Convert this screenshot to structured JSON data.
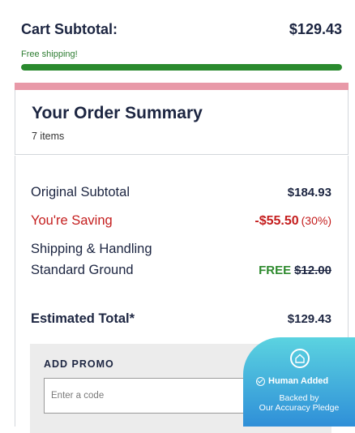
{
  "cart": {
    "subtotal_label": "Cart Subtotal:",
    "subtotal_value": "$129.43",
    "shipping_note": "Free shipping!",
    "shipping_progress": 1.0
  },
  "summary": {
    "title": "Your Order Summary",
    "item_count": "7 items",
    "original_label": "Original Subtotal",
    "original_value": "$184.93",
    "saving_label": "You're Saving",
    "saving_value": "-$55.50",
    "saving_percent": "(30%)",
    "shipping_label": "Shipping & Handling",
    "shipping_method": "Standard Ground",
    "shipping_free": "FREE",
    "shipping_original": "$12.00",
    "total_label": "Estimated Total*",
    "total_value": "$129.43"
  },
  "promo": {
    "title": "ADD PROMO",
    "placeholder": "Enter a code"
  },
  "badge": {
    "line1": "Human Added",
    "line2": "Backed by",
    "line3": "Our Accuracy Pledge"
  },
  "colors": {
    "accent_pink": "#e899a8",
    "progress_green": "#2a8a2e",
    "saving_red": "#c41d1d",
    "badge_cyan": "#5bd3e0",
    "badge_blue": "#2f8fd8"
  }
}
